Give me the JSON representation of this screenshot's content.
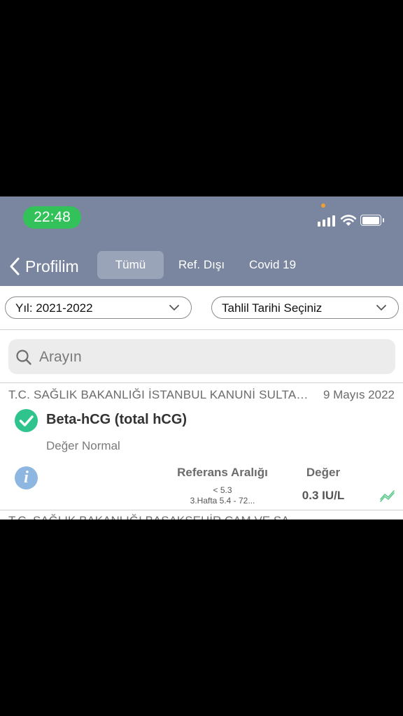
{
  "status_bar": {
    "time": "22:48"
  },
  "nav": {
    "back_label": "Profilim",
    "tabs": [
      {
        "label": "Tümü",
        "active": true
      },
      {
        "label": "Ref. Dışı",
        "active": false
      },
      {
        "label": "Covid 19",
        "active": false
      }
    ]
  },
  "filters": {
    "year": "Yıl: 2021-2022",
    "date": "Tahlil Tarihi Seçiniz"
  },
  "search": {
    "placeholder": "Arayın"
  },
  "result": {
    "hospital": "T.C. SAĞLIK BAKANLIĞI İSTANBUL KANUNİ SULTAN SÜLEYMAN EĞİTİM VE ARAŞTIRMA HASTANESİ",
    "date": "9 Mayıs 2022",
    "test_name": "Beta-hCG (total hCG)",
    "status": "Değer Normal",
    "ref_header": "Referans Aralığı",
    "value_header": "Değer",
    "ref_line1": "< 5.3",
    "ref_line2": "3.Hafta 5.4 - 72...",
    "value": "0.3 IU/L"
  },
  "next_result": {
    "hospital": "T.C. SAĞLIK BAKANLIĞI BAŞAKŞEHİR ÇAM VE SA..."
  },
  "colors": {
    "nav_bg": "#7a869f",
    "check_green": "#2fc48d",
    "info_blue": "#8db7e0",
    "status_green": "#33c159"
  }
}
